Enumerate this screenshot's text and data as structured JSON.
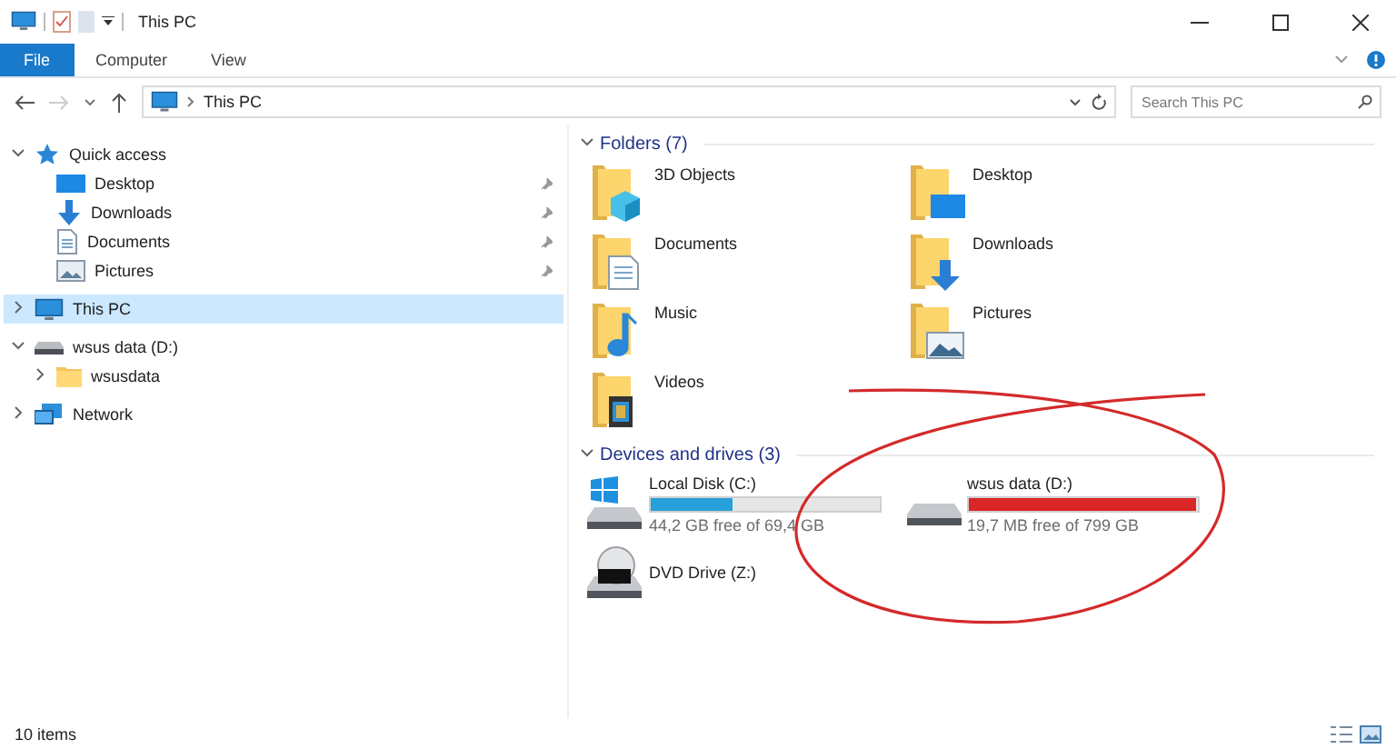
{
  "window": {
    "title": "This PC"
  },
  "ribbon": {
    "tabs": [
      {
        "label": "File",
        "selected": true
      },
      {
        "label": "Computer",
        "selected": false
      },
      {
        "label": "View",
        "selected": false
      }
    ]
  },
  "address": {
    "path": [
      "This PC"
    ]
  },
  "search": {
    "placeholder": "Search This PC"
  },
  "navigation": {
    "items": [
      {
        "label": "Quick access",
        "expanded": true,
        "selected": false,
        "children": [
          {
            "label": "Desktop",
            "pinned": true,
            "selected": false
          },
          {
            "label": "Downloads",
            "pinned": true,
            "selected": false
          },
          {
            "label": "Documents",
            "pinned": true,
            "selected": false
          },
          {
            "label": "Pictures",
            "pinned": true,
            "selected": false
          }
        ]
      },
      {
        "label": "This PC",
        "expanded": false,
        "selected": true
      },
      {
        "label": "wsus data (D:)",
        "expanded": true,
        "selected": false,
        "children": [
          {
            "label": "wsusdata",
            "expanded": false,
            "selected": false
          }
        ]
      },
      {
        "label": "Network",
        "expanded": false,
        "selected": false
      }
    ]
  },
  "folders": {
    "title": "Folders (7)",
    "expanded": true,
    "items": [
      {
        "label": "3D Objects"
      },
      {
        "label": "Desktop"
      },
      {
        "label": "Documents"
      },
      {
        "label": "Downloads"
      },
      {
        "label": "Music"
      },
      {
        "label": "Pictures"
      },
      {
        "label": "Videos"
      }
    ]
  },
  "drives": {
    "title": "Devices and drives (3)",
    "expanded": true,
    "items": [
      {
        "label": "Local Disk (C:)",
        "kind": "system",
        "level": 0.36,
        "free": "44,2 GB free of 69,4 GB"
      },
      {
        "label": "wsus data (D:)",
        "kind": "data",
        "level": 0.99,
        "free": "19,7 MB free of 799 GB"
      },
      {
        "label": "DVD Drive (Z:)",
        "kind": "optical"
      }
    ]
  },
  "status_bar": {
    "count": "10 items"
  }
}
